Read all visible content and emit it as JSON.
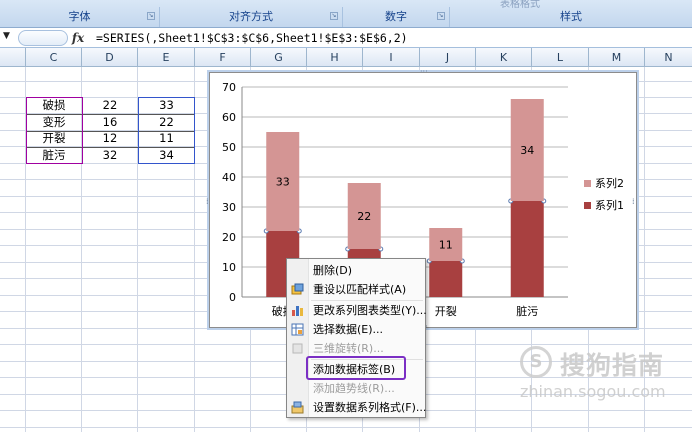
{
  "ribbon": {
    "groups": [
      {
        "label": "字体"
      },
      {
        "label": "对齐方式"
      },
      {
        "label": "数字"
      },
      {
        "label": "样式"
      }
    ],
    "top_partial_text": "表格格式"
  },
  "formula_bar": {
    "fx_label": "fx",
    "formula": "=SERIES(,Sheet1!$C$3:$C$6,Sheet1!$E$3:$E$6,2)"
  },
  "columns": [
    "C",
    "D",
    "E",
    "F",
    "G",
    "H",
    "I",
    "J",
    "K",
    "L",
    "M",
    "N"
  ],
  "table": {
    "rows": [
      {
        "name": "破损",
        "v1": "22",
        "v2": "33"
      },
      {
        "name": "变形",
        "v1": "16",
        "v2": "22"
      },
      {
        "name": "开裂",
        "v1": "12",
        "v2": "11"
      },
      {
        "name": "脏污",
        "v1": "32",
        "v2": "34"
      }
    ]
  },
  "chart_data": {
    "type": "bar",
    "stacked": true,
    "categories": [
      "破损",
      "变形",
      "开裂",
      "脏污"
    ],
    "series": [
      {
        "name": "系列1",
        "values": [
          22,
          16,
          12,
          32
        ],
        "color": "#a84040"
      },
      {
        "name": "系列2",
        "values": [
          33,
          22,
          11,
          34
        ],
        "color": "#d49594",
        "data_labels": [
          "33",
          "22",
          "11",
          "34"
        ]
      }
    ],
    "ylim": [
      0,
      70
    ],
    "yticks": [
      "0",
      "10",
      "20",
      "30",
      "40",
      "50",
      "60",
      "70"
    ],
    "legend": "right",
    "grid": true
  },
  "context_menu": {
    "items": [
      {
        "label": "删除(D)",
        "icon": "none",
        "enabled": true
      },
      {
        "label": "重设以匹配样式(A)",
        "icon": "reset-style-icon",
        "enabled": true
      },
      {
        "label": "更改系列图表类型(Y)...",
        "icon": "chart-type-icon",
        "enabled": true
      },
      {
        "label": "选择数据(E)...",
        "icon": "select-data-icon",
        "enabled": true
      },
      {
        "label": "三维旋转(R)...",
        "icon": "rotate-3d-icon",
        "enabled": false
      },
      {
        "label": "添加数据标签(B)",
        "icon": "none",
        "enabled": true
      },
      {
        "label": "添加趋势线(R)...",
        "icon": "none",
        "enabled": false
      },
      {
        "label": "设置数据系列格式(F)...",
        "icon": "format-series-icon",
        "enabled": true
      }
    ]
  },
  "watermark": {
    "text": "搜狗指南",
    "url": "zhinan.sogou.com"
  }
}
